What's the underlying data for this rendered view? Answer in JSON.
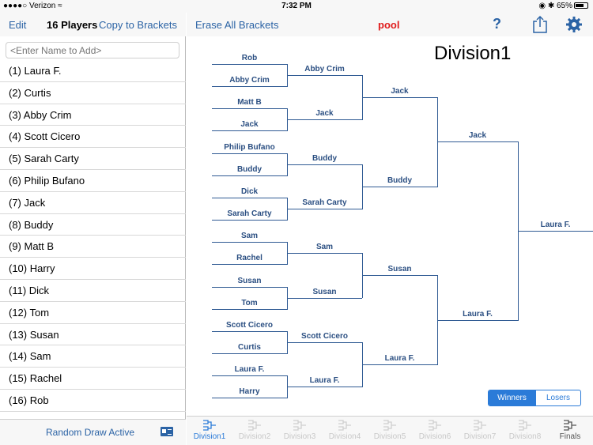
{
  "status_bar": {
    "carrier": "Verizon",
    "time": "7:32 PM",
    "battery": "65%"
  },
  "left_panel": {
    "edit_label": "Edit",
    "player_count": "16 Players",
    "copy_label": "Copy to Brackets",
    "add_placeholder": "<Enter Name to Add>",
    "players": [
      "(1) Laura F.",
      "(2) Curtis",
      "(3) Abby Crim",
      "(4) Scott Cicero",
      "(5) Sarah Carty",
      "(6) Philip Bufano",
      "(7) Jack",
      "(8) Buddy",
      "(9) Matt B",
      "(10) Harry",
      "(11) Dick",
      "(12) Tom",
      "(13) Susan",
      "(14) Sam",
      "(15) Rachel",
      "(16) Rob"
    ],
    "footer_label": "Random Draw Active"
  },
  "header": {
    "erase_label": "Erase All Brackets",
    "pool_label": "pool",
    "help_label": "?"
  },
  "bracket": {
    "division_title": "Division1",
    "round1": [
      "Rob",
      "Abby Crim",
      "Matt B",
      "Jack",
      "Philip Bufano",
      "Buddy",
      "Dick",
      "Sarah Carty",
      "Sam",
      "Rachel",
      "Susan",
      "Tom",
      "Scott Cicero",
      "Curtis",
      "Laura F.",
      "Harry"
    ],
    "round2": [
      "Abby Crim",
      "Jack",
      "Buddy",
      "Sarah Carty",
      "Sam",
      "Susan",
      "Scott Cicero",
      "Laura F."
    ],
    "round3": [
      "Jack",
      "Buddy",
      "Susan",
      "Laura F."
    ],
    "round4": [
      "Jack",
      "Laura F."
    ],
    "champion": "Laura F."
  },
  "segment": {
    "winners_label": "Winners",
    "losers_label": "Losers"
  },
  "tabs": [
    "Division1",
    "Division2",
    "Division3",
    "Division4",
    "Division5",
    "Division6",
    "Division7",
    "Division8",
    "Finals"
  ],
  "colors": {
    "accent": "#2b7bd8",
    "bracket_line": "#2f5a93",
    "pool_red": "#e01b1b"
  }
}
